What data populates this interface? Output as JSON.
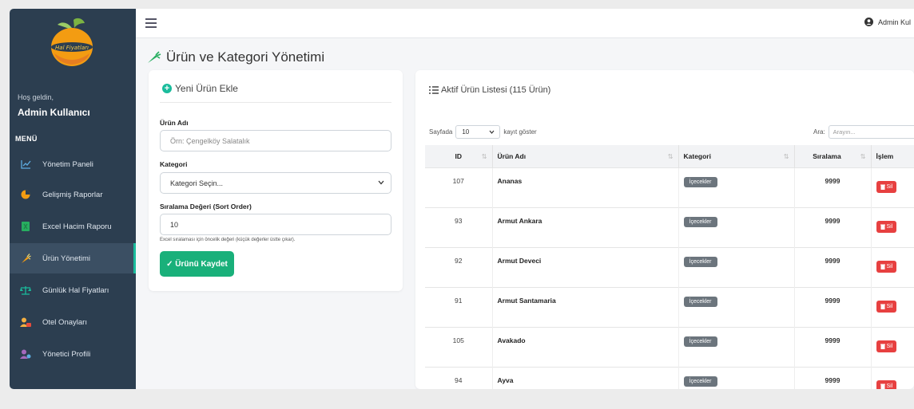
{
  "colors": {
    "sidebar": "#2c3e50",
    "accent": "#1abc9c",
    "save": "#19b07a",
    "delete": "#e74040",
    "badge": "#6c757d"
  },
  "brand": {
    "logo_text": "Hal Fiyatları"
  },
  "sidebar": {
    "greeting": "Hoş geldin,",
    "user_name": "Admin Kullanıcı",
    "menu_title": "MENÜ",
    "items": [
      {
        "label": "Yönetim Paneli",
        "icon": "chart-line-icon"
      },
      {
        "label": "Gelişmiş Raporlar",
        "icon": "pie-chart-icon"
      },
      {
        "label": "Excel Hacim Raporu",
        "icon": "excel-file-icon"
      },
      {
        "label": "Ürün Yönetimi",
        "icon": "carrot-icon"
      },
      {
        "label": "Günlük Hal Fiyatları",
        "icon": "scale-icon"
      },
      {
        "label": "Otel Onayları",
        "icon": "user-check-icon"
      },
      {
        "label": "Yönetici Profili",
        "icon": "user-cog-icon"
      }
    ]
  },
  "topbar": {
    "user_label": "Admin Kul"
  },
  "page": {
    "title": "Ürün ve Kategori Yönetimi"
  },
  "form": {
    "header": "Yeni Ürün Ekle",
    "name_label": "Ürün Adı",
    "name_placeholder": "Örn: Çengelköy Salatalık",
    "category_label": "Kategori",
    "category_selected": "Kategori Seçin...",
    "order_label": "Sıralama Değeri (Sort Order)",
    "order_value": "10",
    "order_hint": "Excel sıralaması için öncelik değeri (küçük değerler üstte çıkar).",
    "save_label": "✓ Ürünü Kaydet"
  },
  "list": {
    "header": "Aktif Ürün Listesi (115 Ürün)",
    "length_prefix": "Sayfada",
    "length_value": "10",
    "length_suffix": "kayıt göster",
    "search_label": "Ara:",
    "search_placeholder": "Arayın...",
    "columns": [
      "ID",
      "Ürün Adı",
      "Kategori",
      "Sıralama",
      "İşlem"
    ],
    "delete_label": "Sil",
    "rows": [
      {
        "id": "107",
        "name": "Ananas",
        "category": "İçecekler",
        "order": "9999"
      },
      {
        "id": "93",
        "name": "Armut Ankara",
        "category": "İçecekler",
        "order": "9999"
      },
      {
        "id": "92",
        "name": "Armut Deveci",
        "category": "İçecekler",
        "order": "9999"
      },
      {
        "id": "91",
        "name": "Armut Santamaria",
        "category": "İçecekler",
        "order": "9999"
      },
      {
        "id": "105",
        "name": "Avakado",
        "category": "İçecekler",
        "order": "9999"
      },
      {
        "id": "94",
        "name": "Ayva",
        "category": "İçecekler",
        "order": "9999"
      }
    ]
  }
}
